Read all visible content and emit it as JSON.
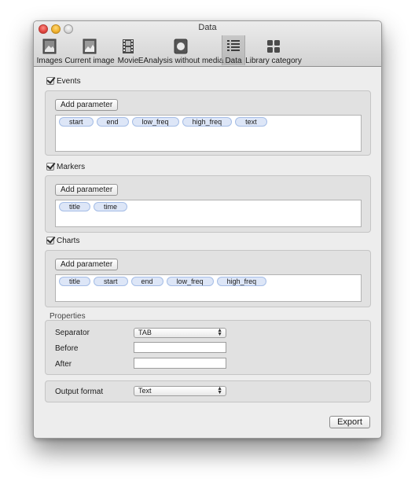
{
  "window": {
    "title": "Data"
  },
  "toolbar": {
    "items": [
      {
        "label": "Images",
        "icon": "images-icon",
        "active": false
      },
      {
        "label": "Current image",
        "icon": "current-image-icon",
        "active": false
      },
      {
        "label": "Movie",
        "icon": "movie-icon",
        "active": false
      },
      {
        "label": "EAnalysis without media",
        "icon": "eanalysis-icon",
        "active": false
      },
      {
        "label": "Data",
        "icon": "data-list-icon",
        "active": true
      },
      {
        "label": "Library category",
        "icon": "library-category-icon",
        "active": false
      }
    ]
  },
  "events": {
    "label": "Events",
    "checked": true,
    "add_button": "Add parameter",
    "tokens": [
      "start",
      "end",
      "low_freq",
      "high_freq",
      "text"
    ]
  },
  "markers": {
    "label": "Markers",
    "checked": true,
    "add_button": "Add parameter",
    "tokens": [
      "title",
      "time"
    ]
  },
  "charts": {
    "label": "Charts",
    "checked": true,
    "add_button": "Add parameter",
    "tokens": [
      "title",
      "start",
      "end",
      "low_freq",
      "high_freq"
    ]
  },
  "properties": {
    "heading": "Properties",
    "separator_label": "Separator",
    "separator_value": "TAB",
    "before_label": "Before",
    "before_value": "",
    "after_label": "After",
    "after_value": ""
  },
  "output": {
    "label": "Output format",
    "value": "Text"
  },
  "export_button": "Export"
}
